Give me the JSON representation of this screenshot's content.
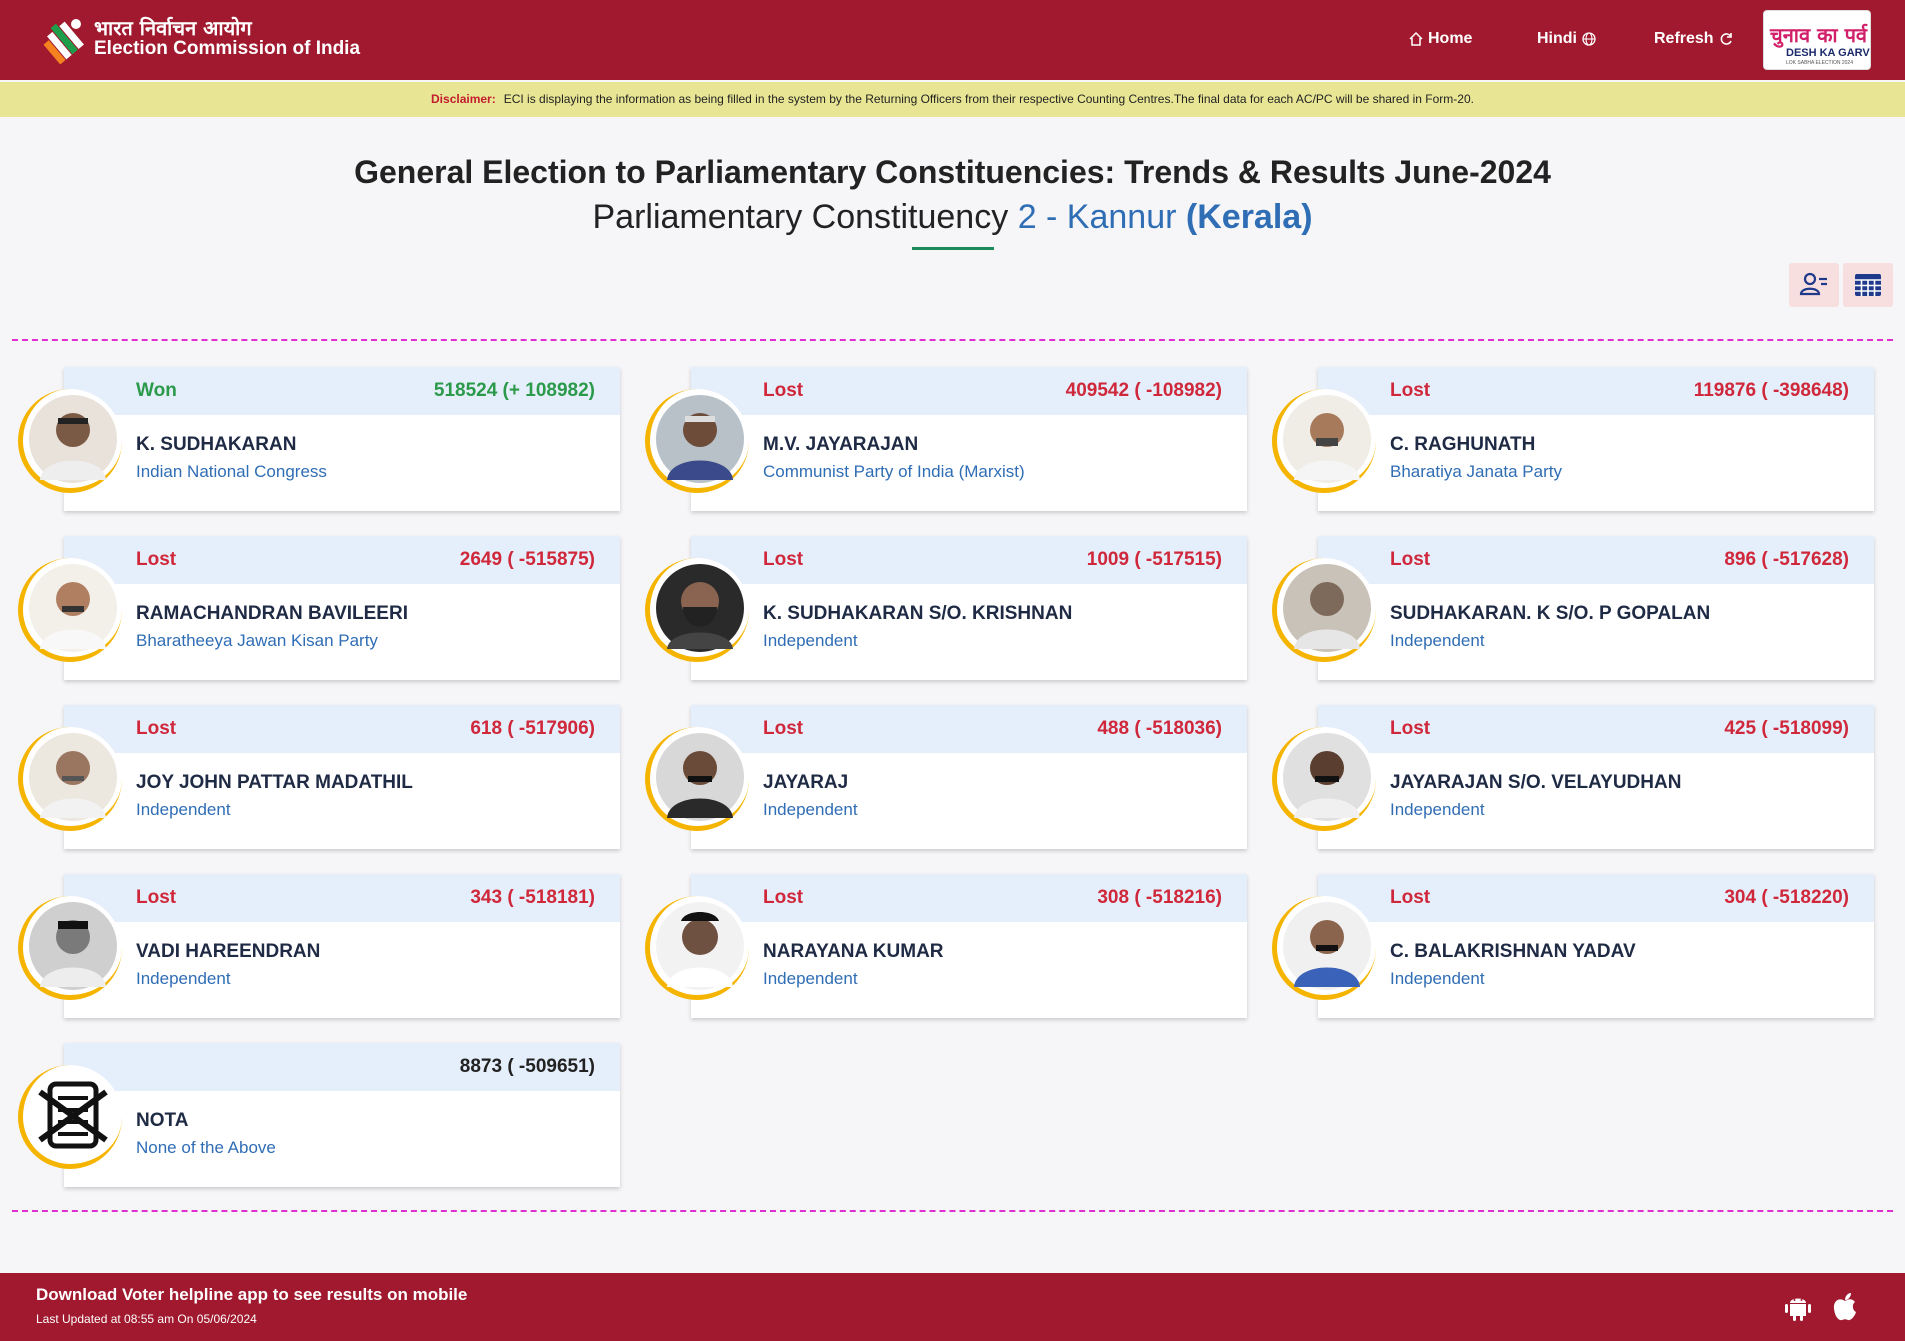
{
  "header": {
    "brand_hi": "भारत निर्वाचन आयोग",
    "brand_en": "Election Commission of India",
    "nav_home": "Home",
    "nav_hindi": "Hindi",
    "nav_refresh": "Refresh",
    "badge_hi": "चुनाव का पर्व",
    "badge_en": "DESH KA GARV",
    "badge_sub": "LOK SABHA ELECTION 2024"
  },
  "disclaimer": {
    "label": "Disclaimer:",
    "text": "ECI is displaying the information as being filled in the system by the Returning Officers from their respective Counting Centres.The final data for each AC/PC will be shared in Form-20."
  },
  "page": {
    "title": "General Election to Parliamentary Constituencies: Trends & Results June-2024",
    "subtitle_prefix": "Parliamentary Constituency",
    "constituency": "2 - Kannur",
    "state": "(Kerala)"
  },
  "candidates": [
    {
      "status": "Won",
      "votes": "518524 (+ 108982)",
      "name": "K. SUDHAKARAN",
      "party": "Indian National Congress"
    },
    {
      "status": "Lost",
      "votes": "409542 ( -108982)",
      "name": "M.V. JAYARAJAN",
      "party": "Communist Party of India (Marxist)"
    },
    {
      "status": "Lost",
      "votes": "119876 ( -398648)",
      "name": "C. RAGHUNATH",
      "party": "Bharatiya Janata Party"
    },
    {
      "status": "Lost",
      "votes": "2649 ( -515875)",
      "name": "RAMACHANDRAN BAVILEERI",
      "party": "Bharatheeya Jawan Kisan Party"
    },
    {
      "status": "Lost",
      "votes": "1009 ( -517515)",
      "name": "K. SUDHAKARAN S/O. KRISHNAN",
      "party": "Independent"
    },
    {
      "status": "Lost",
      "votes": "896 ( -517628)",
      "name": "SUDHAKARAN. K S/O. P GOPALAN",
      "party": "Independent"
    },
    {
      "status": "Lost",
      "votes": "618 ( -517906)",
      "name": "JOY JOHN PATTAR MADATHIL",
      "party": "Independent"
    },
    {
      "status": "Lost",
      "votes": "488 ( -518036)",
      "name": "JAYARAJ",
      "party": "Independent"
    },
    {
      "status": "Lost",
      "votes": "425 ( -518099)",
      "name": "JAYARAJAN S/O. VELAYUDHAN",
      "party": "Independent"
    },
    {
      "status": "Lost",
      "votes": "343 ( -518181)",
      "name": "VADI HAREENDRAN",
      "party": "Independent"
    },
    {
      "status": "Lost",
      "votes": "308 ( -518216)",
      "name": "NARAYANA KUMAR",
      "party": "Independent"
    },
    {
      "status": "Lost",
      "votes": "304 ( -518220)",
      "name": "C. BALAKRISHNAN YADAV",
      "party": "Independent"
    },
    {
      "status": "",
      "votes": "8873 ( -509651)",
      "name": "NOTA",
      "party": "None of the Above"
    }
  ],
  "footer": {
    "download_text": "Download Voter helpline app to see results on mobile",
    "last_updated": "Last Updated at 08:55 am On 05/06/2024"
  },
  "colors": {
    "brand": "#a0192e",
    "won": "#2b9a4a",
    "lost": "#d0283b",
    "link": "#2f6db5",
    "disclaimer_bg": "#e8e694"
  }
}
